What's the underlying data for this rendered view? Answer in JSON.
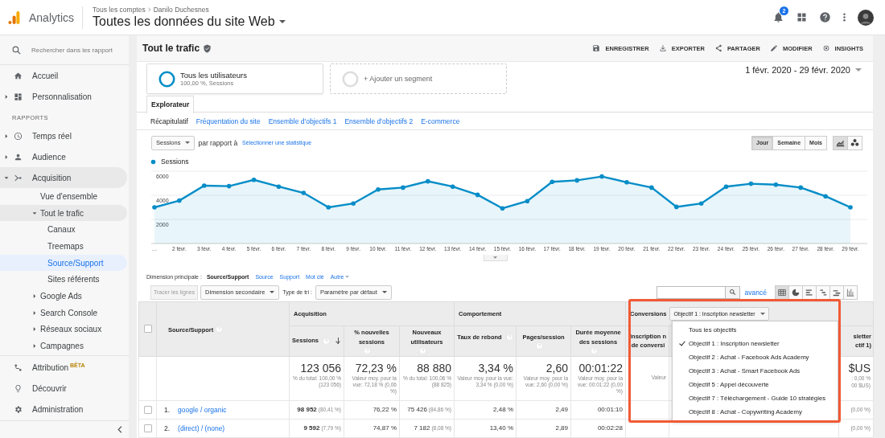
{
  "topbar": {
    "app": "Analytics",
    "breadcrumb": [
      "Tous les comptes",
      "Danilo Duchesnes"
    ],
    "property": "Toutes les données du site Web",
    "notifications": "2"
  },
  "sidebar": {
    "search": {
      "placeholder": "Rechercher dans les rapport"
    },
    "groups": [
      {
        "items": [
          {
            "label": "Accueil",
            "selected": false
          },
          {
            "label": "Personnalisation",
            "expanded": false,
            "selected": false
          }
        ]
      },
      {
        "title": "RAPPORTS",
        "items": [
          {
            "label": "Temps réel",
            "expanded": false,
            "selected": false
          },
          {
            "label": "Audience",
            "expanded": false,
            "selected": false
          },
          {
            "label": "Acquisition",
            "expanded": true,
            "selected": false,
            "children": [
              {
                "label": "Vue d'ensemble",
                "selected": false
              },
              {
                "label": "Tout le trafic",
                "expanded": true,
                "selected": false,
                "children": [
                  {
                    "label": "Canaux",
                    "selected": false
                  },
                  {
                    "label": "Treemaps",
                    "selected": false
                  },
                  {
                    "label": "Source/Support",
                    "selected": true
                  },
                  {
                    "label": "Sites référents",
                    "selected": false
                  }
                ]
              },
              {
                "label": "Google Ads",
                "expanded": false,
                "selected": false
              },
              {
                "label": "Search Console",
                "expanded": false,
                "selected": false
              },
              {
                "label": "Réseaux sociaux",
                "expanded": false,
                "selected": false
              },
              {
                "label": "Campagnes",
                "expanded": false,
                "selected": false
              }
            ]
          }
        ]
      },
      {
        "items": [
          {
            "label": "Attribution",
            "badge": "BÊTA",
            "selected": false
          },
          {
            "label": "Découvrir",
            "selected": false
          },
          {
            "label": "Administration",
            "selected": false
          }
        ]
      }
    ]
  },
  "report": {
    "title": "Tout le trafic",
    "actions": [
      "ENREGISTRER",
      "EXPORTER",
      "PARTAGER",
      "MODIFIER",
      "INSIGHTS"
    ],
    "segments": [
      {
        "name": "Tous les utilisateurs",
        "detail": "100,00 %, Sessions"
      }
    ],
    "add_segment": "+ Ajouter un segment",
    "date_range": "1 févr. 2020 - 29 févr. 2020",
    "tabs": [
      {
        "label": "Explorateur",
        "selected": true
      }
    ],
    "subtabs": [
      {
        "label": "Récapitulatif",
        "selected": true
      },
      {
        "label": "Fréquentation du site",
        "selected": false
      },
      {
        "label": "Ensemble d'objectifs 1",
        "selected": false
      },
      {
        "label": "Ensemble d'objectifs 2",
        "selected": false
      },
      {
        "label": "E-commerce",
        "selected": false
      }
    ],
    "metric_select": "Sessions",
    "compare_label": "par rapport à",
    "compare_link": "Sélectionner une statistique",
    "periods": [
      {
        "label": "Jour",
        "selected": true
      },
      {
        "label": "Semaine",
        "selected": false
      },
      {
        "label": "Mois",
        "selected": false
      }
    ],
    "chart_modes": [
      {
        "selected": true
      },
      {
        "selected": false
      }
    ],
    "chart_data": {
      "type": "area",
      "categories": [
        "…",
        "2 févr.",
        "3 févr.",
        "4 févr.",
        "5 févr.",
        "6 févr.",
        "7 févr.",
        "8 févr.",
        "9 févr.",
        "10 févr.",
        "11 févr.",
        "12 févr.",
        "13 févr.",
        "14 févr.",
        "15 févr.",
        "16 févr.",
        "17 févr.",
        "18 févr.",
        "19 févr.",
        "20 févr.",
        "21 févr.",
        "22 févr.",
        "23 févr.",
        "24 févr.",
        "25 févr.",
        "26 févr.",
        "27 févr.",
        "28 févr.",
        "29 févr."
      ],
      "series": [
        {
          "name": "Sessions",
          "color": "#058dc7",
          "values": [
            3000,
            3560,
            4800,
            4760,
            5280,
            4720,
            4200,
            3000,
            3320,
            4480,
            4640,
            5160,
            4720,
            4040,
            2920,
            3520,
            5120,
            5240,
            5560,
            5080,
            4640,
            3040,
            3320,
            4720,
            4960,
            4880,
            4640,
            3920,
            3000
          ]
        }
      ],
      "ylim": [
        0,
        6000
      ],
      "yticks": [
        {
          "value": 2000,
          "label": "2000"
        },
        {
          "value": 4000,
          "label": "4000"
        },
        {
          "value": 6000,
          "label": "6000"
        }
      ]
    }
  },
  "dimensions": {
    "label": "Dimension principale :",
    "options": [
      {
        "label": "Source/Support",
        "selected": true
      },
      {
        "label": "Source",
        "selected": false
      },
      {
        "label": "Support",
        "selected": false
      },
      {
        "label": "Mot clé",
        "selected": false
      },
      {
        "label": "Autre",
        "selected": false
      }
    ]
  },
  "toolbar": {
    "plot_rows": {
      "label": "Tracer les lignes",
      "disabled": true
    },
    "secondary": "Dimension secondaire",
    "sort_label": "Type de tri :",
    "sort": "Paramètre par défaut",
    "advanced": "avancé",
    "views": [
      {
        "selected": true
      },
      {
        "selected": false
      },
      {
        "selected": false
      },
      {
        "selected": false
      },
      {
        "selected": false
      },
      {
        "selected": false
      }
    ]
  },
  "table": {
    "all_selected": false,
    "first_column": "Source/Support",
    "groups": [
      {
        "label": "Acquisition",
        "columns": [
          {
            "label": "Sessions",
            "sorted": true
          },
          {
            "label": "% nouvelles sessions",
            "sorted": false
          },
          {
            "label": "Nouveaux utilisateurs",
            "sorted": false
          }
        ]
      },
      {
        "label": "Comportement",
        "columns": [
          {
            "label": "Taux de rebond",
            "sorted": false
          },
          {
            "label": "Pages/session",
            "sorted": false
          },
          {
            "label": "Durée moyenne des sessions",
            "sorted": false
          }
        ]
      }
    ],
    "totals": [
      {
        "value": "123 056",
        "note": "% du total: 100,00 % (123 056)"
      },
      {
        "value": "72,23 %",
        "note": "Valeur moy. pour la vue: 72,18 % (0,06 %)"
      },
      {
        "value": "88 880",
        "note": "% du total: 100,06 % (88 825)"
      },
      {
        "value": "3,34 %",
        "note": "Valeur moy. pour la vue: 3,34 % (0,00 %)"
      },
      {
        "value": "2,60",
        "note": "Valeur moy. pour la vue: 2,60 (0,00 %)"
      },
      {
        "value": "00:01:22",
        "note": "Valeur moy. pour la vue: 00:01:22 (0,00 %)"
      }
    ],
    "rows": [
      {
        "rank": "1.",
        "source": "google / organic",
        "selected": false,
        "cells": [
          {
            "value": "98 952",
            "share": "(80,41 %)"
          },
          {
            "value": "76,22 %"
          },
          {
            "value": "75 426",
            "share": "(84,86 %)"
          },
          {
            "value": "2,48 %"
          },
          {
            "value": "2,49"
          },
          {
            "value": "00:01:10"
          }
        ],
        "conversion_tail": "(0,00 %)"
      },
      {
        "rank": "2.",
        "source": "(direct) / (none)",
        "selected": false,
        "cells": [
          {
            "value": "9 592",
            "share": "(7,79 %)"
          },
          {
            "value": "74,87 %"
          },
          {
            "value": "7 182",
            "share": "(8,08 %)"
          },
          {
            "value": "13,40 %"
          },
          {
            "value": "2,89"
          },
          {
            "value": "00:02:28"
          }
        ],
        "conversion_tail": "(0,00 %)"
      }
    ]
  },
  "conversions": {
    "label": "Conversions",
    "goal": "Objectif 1 : Inscription newsletter",
    "column_left": [
      "Inscription n",
      "de conversi"
    ],
    "column_right": [
      "sletter",
      "ctif 1)"
    ],
    "totals_left": "Valeur",
    "totals_right": {
      "value": "$US",
      "notes": [
        ": 0,00 %",
        "00 $US)"
      ]
    },
    "options": [
      {
        "label": "Tous les objectifs",
        "selected": false
      },
      {
        "label": "Objectif 1 : Inscription newsletter",
        "selected": true
      },
      {
        "label": "Objectif 2 : Achat - Facebook Ads Academy",
        "selected": false
      },
      {
        "label": "Objectif 3 : Achat - Smart Facebook Ads",
        "selected": false
      },
      {
        "label": "Objectif 5 : Appel découverte",
        "selected": false
      },
      {
        "label": "Objectif 7 : Téléchargement - Guide 10 stratégies",
        "selected": false
      },
      {
        "label": "Objectif 8 : Achat - Copywriting Academy",
        "selected": false
      }
    ]
  }
}
